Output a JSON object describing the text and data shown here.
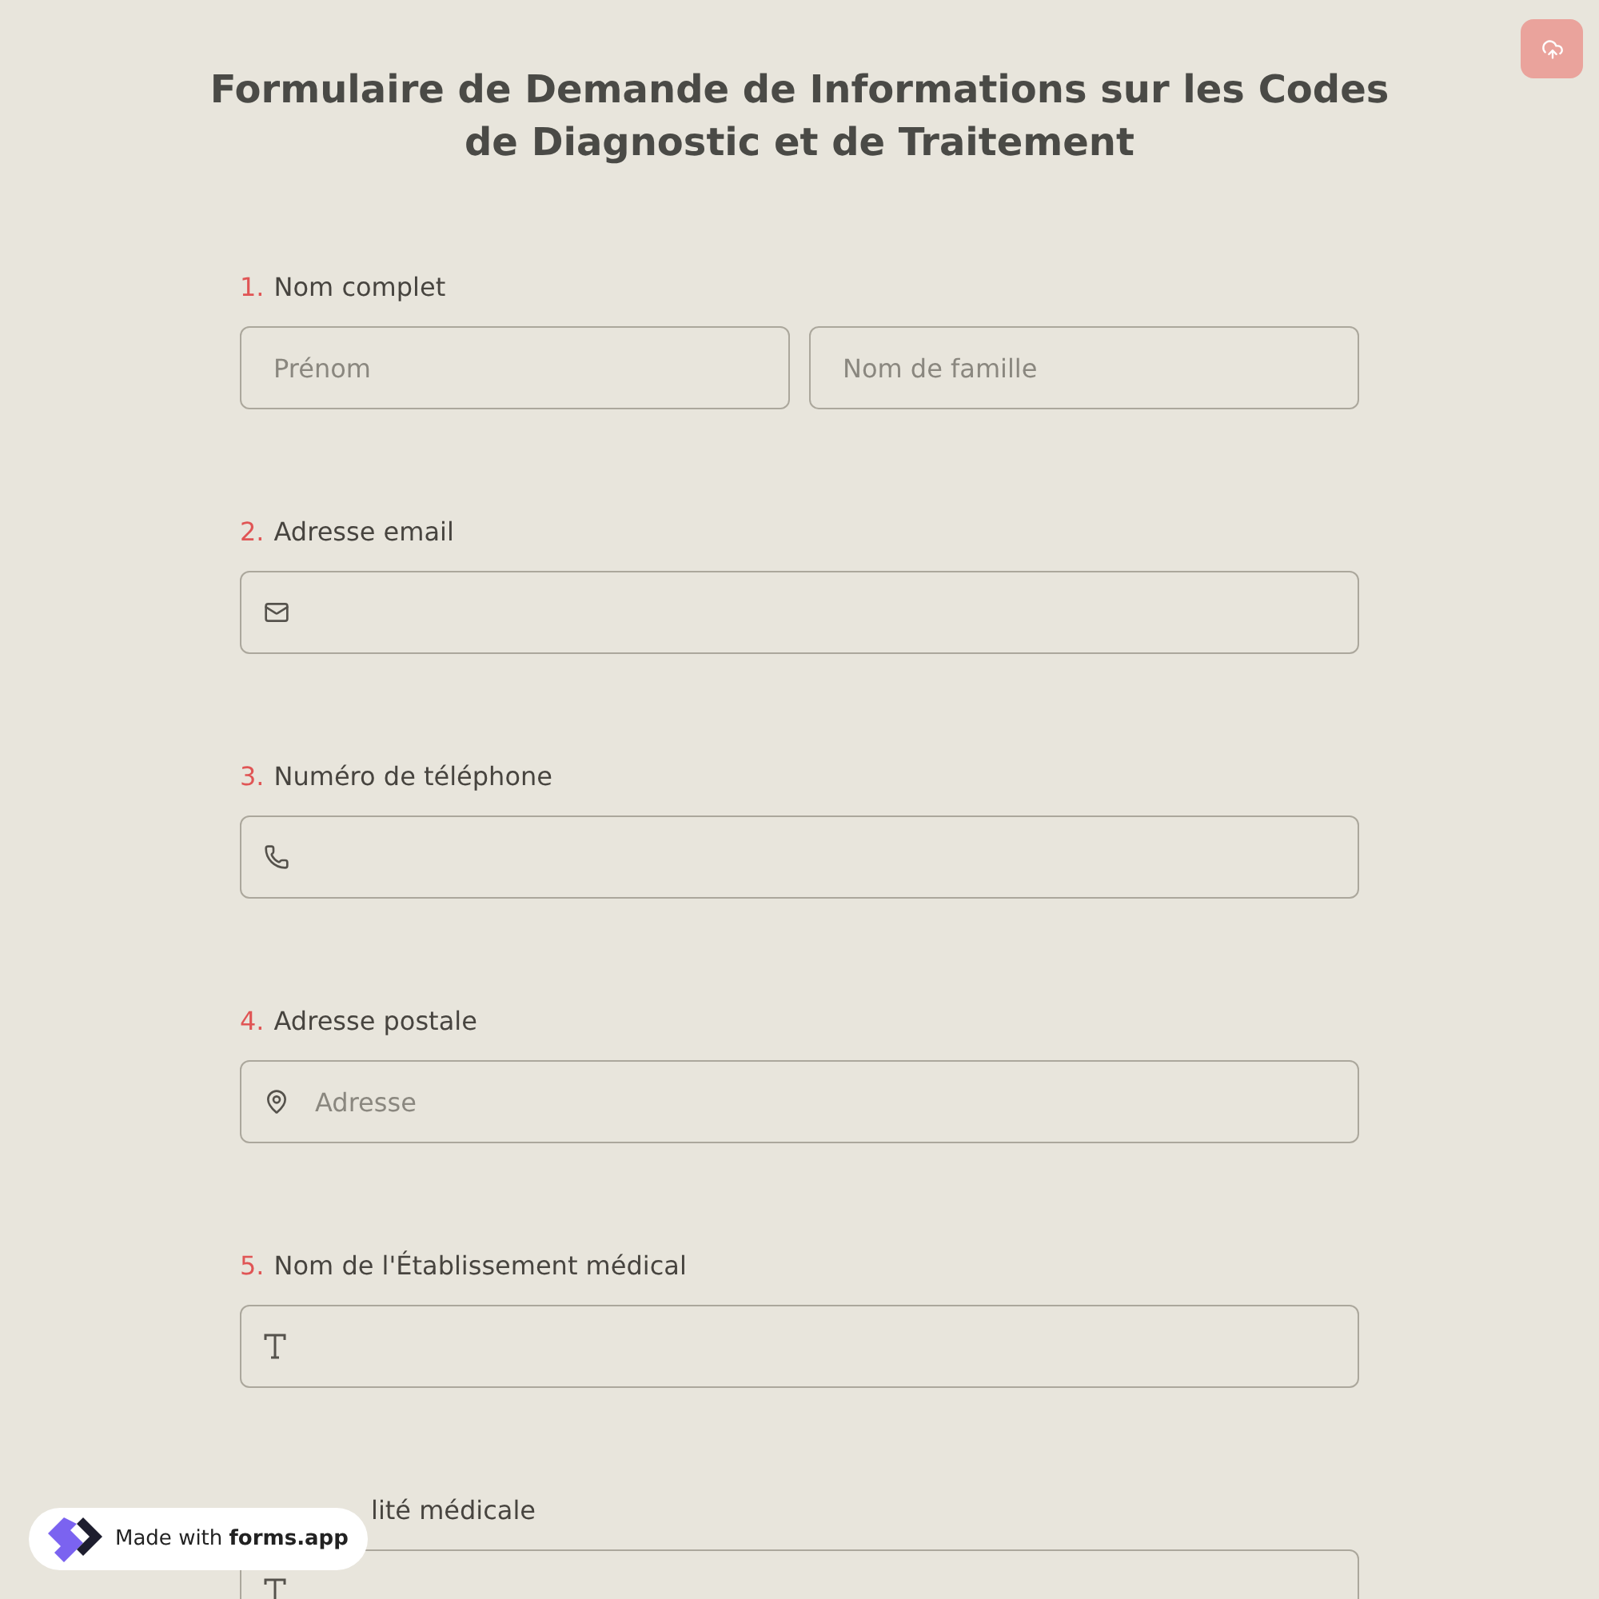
{
  "title": "Formulaire de Demande de Informations sur les Codes de Diagnostic et de Traitement",
  "questions": [
    {
      "number": "1.",
      "label": "Nom complet",
      "kind": "name",
      "fields": [
        {
          "placeholder": "Prénom"
        },
        {
          "placeholder": "Nom de famille"
        }
      ]
    },
    {
      "number": "2.",
      "label": "Adresse email",
      "kind": "email"
    },
    {
      "number": "3.",
      "label": "Numéro de téléphone",
      "kind": "phone"
    },
    {
      "number": "4.",
      "label": "Adresse postale",
      "kind": "address",
      "fields": [
        {
          "placeholder": "Adresse"
        }
      ]
    },
    {
      "number": "5.",
      "label": "Nom de l'Établissement médical",
      "kind": "text"
    },
    {
      "label": "lité médicale",
      "kind": "text",
      "covered": true
    }
  ],
  "badge": {
    "text": "Made with **forms.app**"
  }
}
